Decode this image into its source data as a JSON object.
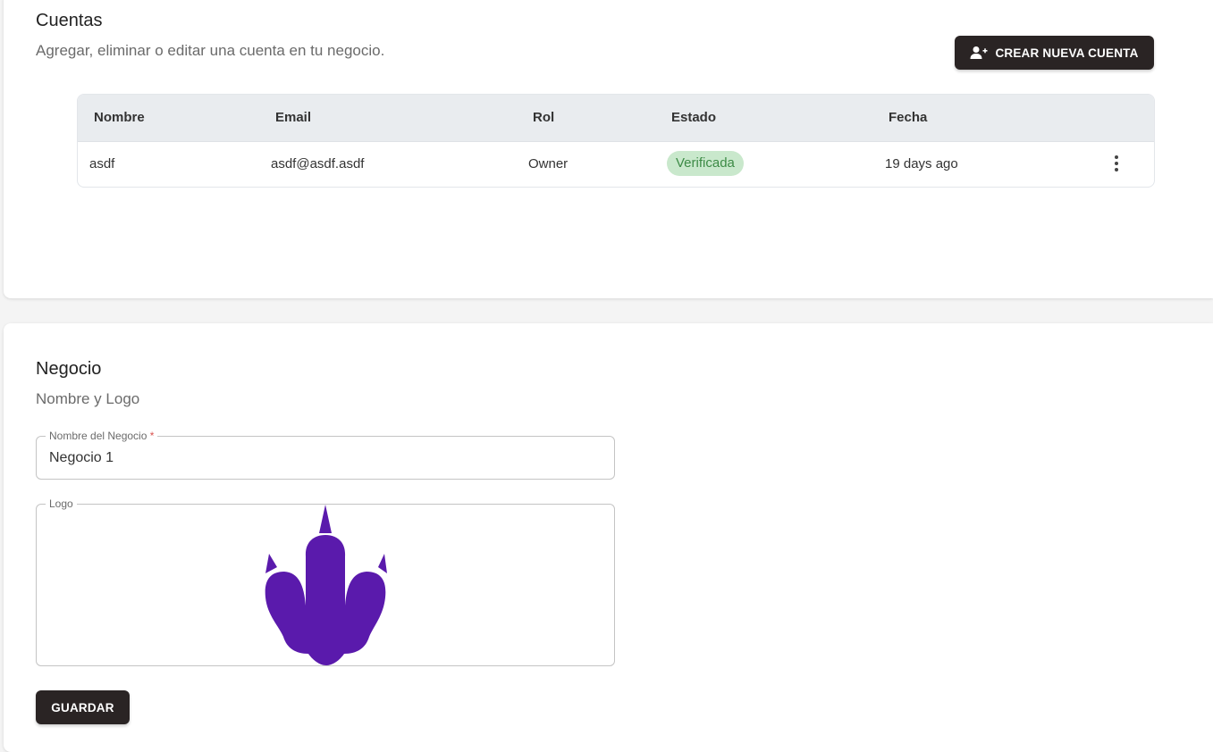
{
  "accounts": {
    "title": "Cuentas",
    "subtitle": "Agregar, eliminar o editar una cuenta en tu negocio.",
    "create_button": {
      "label": "CREAR NUEVA CUENTA",
      "icon": "person-add-icon"
    },
    "table": {
      "columns": [
        "Nombre",
        "Email",
        "Rol",
        "Estado",
        "Fecha"
      ],
      "rows": [
        {
          "nombre": "asdf",
          "email": "asdf@asdf.asdf",
          "rol": "Owner",
          "estado": "Verificada",
          "fecha": "19 days ago",
          "menu_icon": "more-vert-icon"
        }
      ]
    },
    "colors": {
      "button_bg": "#2a2424",
      "header_bg": "#e9ecef",
      "badge_bg": "#c9e8cc",
      "badge_text": "#3d8b46"
    }
  },
  "business": {
    "title": "Negocio",
    "subtitle": "Nombre y Logo",
    "name_field": {
      "label": "Nombre del Negocio",
      "required_mark": "*",
      "value": "Negocio 1"
    },
    "logo_field": {
      "label": "Logo",
      "image": "purple-dinosaur-footprint-logo",
      "logo_color": "#5a1aac"
    },
    "save_button": {
      "label": "GUARDAR"
    }
  }
}
